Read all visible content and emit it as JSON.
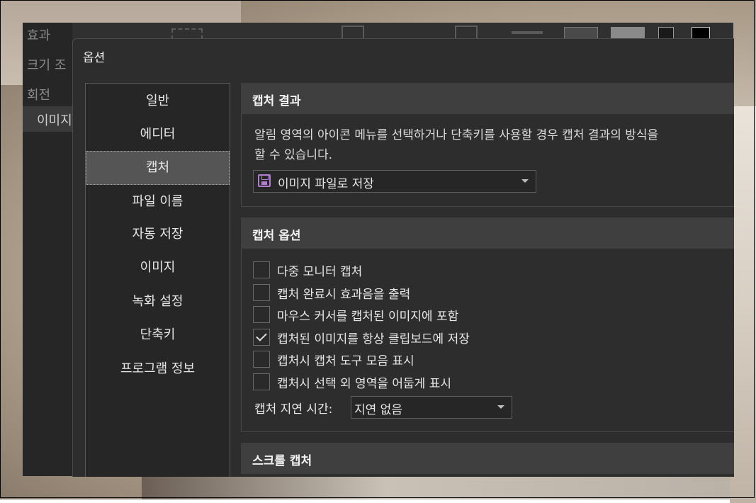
{
  "background_app": {
    "side_items": [
      "효과",
      "크기 조",
      "회전",
      "이미지"
    ]
  },
  "dialog": {
    "title": "옵션",
    "nav": [
      {
        "label": "일반"
      },
      {
        "label": "에디터"
      },
      {
        "label": "캡처",
        "selected": true
      },
      {
        "label": "파일 이름"
      },
      {
        "label": "자동 저장"
      },
      {
        "label": "이미지"
      },
      {
        "label": "녹화 설정"
      },
      {
        "label": "단축키"
      },
      {
        "label": "프로그램 정보"
      }
    ],
    "capture_result": {
      "header": "캡처 결과",
      "desc_line1": "알림 영역의 아이콘 메뉴를 선택하거나 단축키를 사용할 경우 캡처 결과의 방식을",
      "desc_line2": "할 수 있습니다.",
      "select_value": "이미지 파일로 저장",
      "select_icon": "save-icon"
    },
    "capture_options": {
      "header": "캡처 옵션",
      "checkboxes": [
        {
          "label": "다중 모니터 캡처",
          "checked": false
        },
        {
          "label": "캡처 완료시 효과음을 출력",
          "checked": false
        },
        {
          "label": "마우스 커서를 캡처된 이미지에 포함",
          "checked": false
        },
        {
          "label": "캡처된 이미지를 항상 클립보드에 저장",
          "checked": true
        },
        {
          "label": "캡처시 캡처 도구 모음 표시",
          "checked": false
        },
        {
          "label": "캡처시 선택 외 영역을 어둡게 표시",
          "checked": false
        }
      ],
      "delay_label": "캡처 지연 시간:",
      "delay_value": "지연 없음"
    },
    "scroll_capture": {
      "header": "스크롤 캡처"
    }
  },
  "colors": {
    "dialog_bg": "#2d2d2d",
    "section_header_bg": "#3f3f3f",
    "nav_selected_bg": "#555555",
    "save_icon": "#b07fd0"
  }
}
